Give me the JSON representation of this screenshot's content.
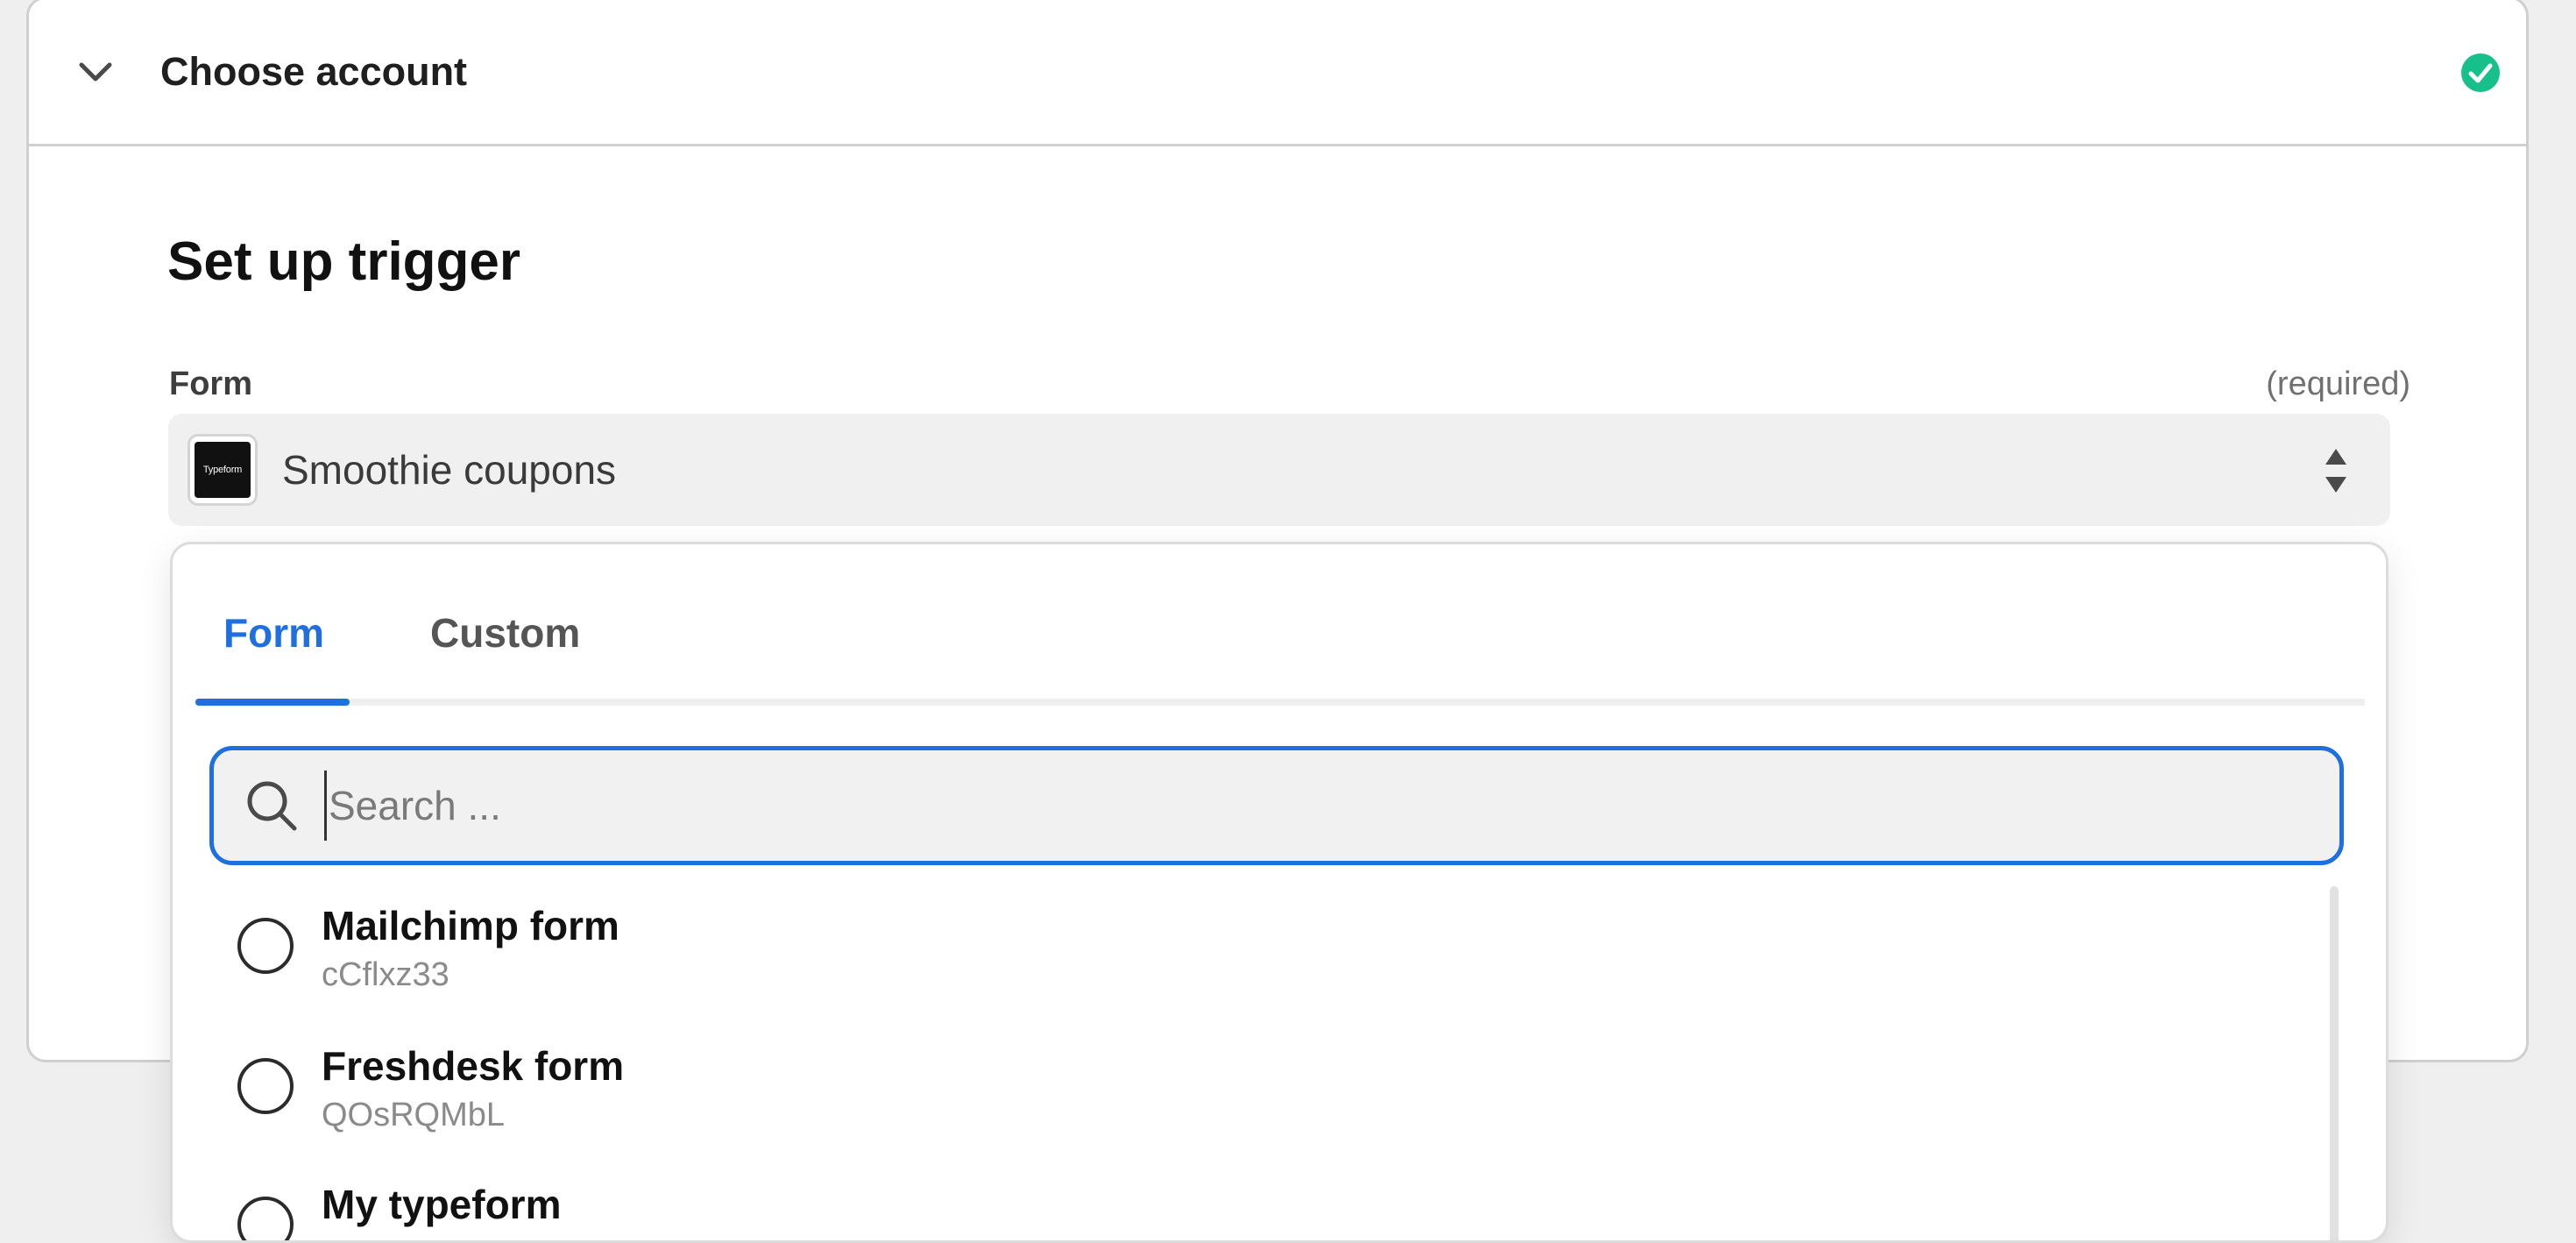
{
  "section": {
    "title": "Choose account",
    "status_color": "#17c08a"
  },
  "setup": {
    "title": "Set up trigger"
  },
  "field": {
    "label": "Form",
    "required_text": "(required)",
    "selected_value": "Smoothie coupons",
    "app_logo_text": "Typeform"
  },
  "dropdown": {
    "tabs": [
      {
        "label": "Form",
        "active": true
      },
      {
        "label": "Custom",
        "active": false
      }
    ],
    "search": {
      "placeholder": "Search ...",
      "value": ""
    },
    "options": [
      {
        "title": "Mailchimp form",
        "subtitle": "cCflxz33"
      },
      {
        "title": "Freshdesk form",
        "subtitle": "QOsRQMbL"
      },
      {
        "title": "My typeform",
        "subtitle": ""
      }
    ]
  },
  "colors": {
    "accent": "#1f6fe0",
    "success": "#17c08a"
  },
  "icons": {
    "collapse": "chevron-down-icon",
    "status": "check-circle-icon",
    "select_arrows": "updown-arrows-icon",
    "search": "search-icon"
  }
}
